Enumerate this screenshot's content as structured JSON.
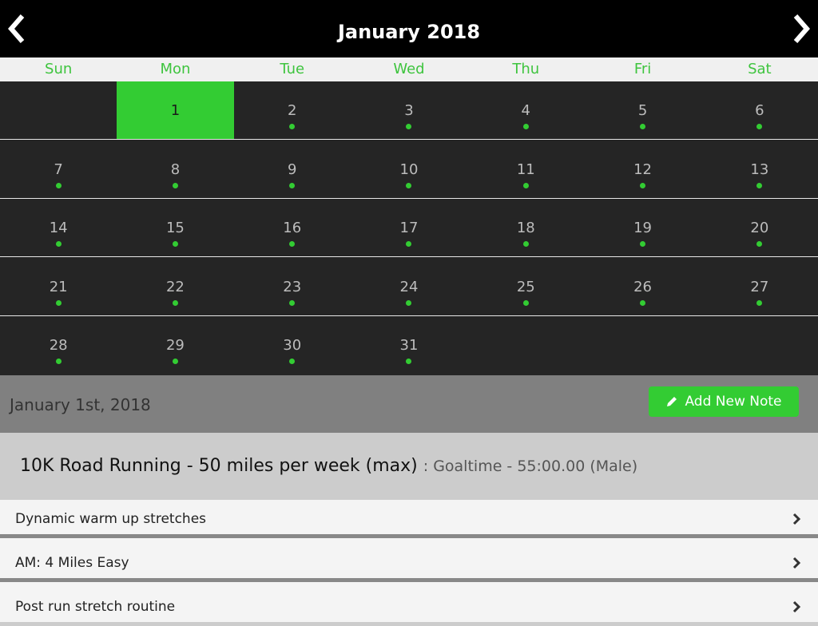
{
  "header": {
    "title": "January 2018",
    "prev_icon": "chevron-left-icon",
    "next_icon": "chevron-right-icon"
  },
  "weekdays": [
    "Sun",
    "Mon",
    "Tue",
    "Wed",
    "Thu",
    "Fri",
    "Sat"
  ],
  "calendar": {
    "first_weekday_index": 1,
    "days_in_month": 31,
    "selected_day": 1,
    "days_with_events": [
      2,
      3,
      4,
      5,
      6,
      7,
      8,
      9,
      10,
      11,
      12,
      13,
      14,
      15,
      16,
      17,
      18,
      19,
      20,
      21,
      22,
      23,
      24,
      25,
      26,
      27,
      28,
      29,
      30,
      31
    ],
    "accent_color": "#33cc33"
  },
  "selected_date": {
    "label": "January 1st, 2018",
    "add_note_label": "Add New Note",
    "add_note_icon": "pencil-icon"
  },
  "plan": {
    "title": "10K Road Running - 50 miles per week (max)",
    "subtitle": ": Goaltime - 55:00.00 (Male)"
  },
  "workouts": [
    {
      "label": "Dynamic warm up stretches"
    },
    {
      "label": "AM: 4 Miles Easy"
    },
    {
      "label": "Post run stretch routine"
    }
  ]
}
